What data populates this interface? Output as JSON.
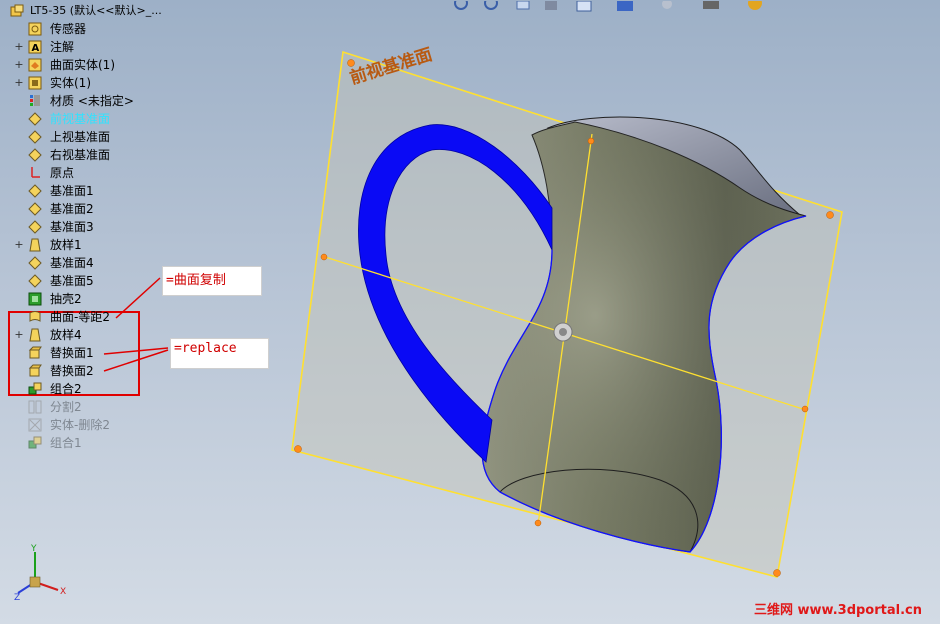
{
  "tree": {
    "root": "LT5-35  (默认<<默认>_...",
    "items": [
      {
        "label": "传感器",
        "icon": "sensor-icon",
        "expander": ""
      },
      {
        "label": "注解",
        "icon": "annotation-icon",
        "expander": "+"
      },
      {
        "label": "曲面实体(1)",
        "icon": "surface-bodies-icon",
        "expander": "+"
      },
      {
        "label": "实体(1)",
        "icon": "solid-bodies-icon",
        "expander": "+"
      },
      {
        "label": "材质 <未指定>",
        "icon": "material-icon",
        "expander": ""
      },
      {
        "label": "前视基准面",
        "icon": "plane-icon",
        "expander": "",
        "state": "selected"
      },
      {
        "label": "上视基准面",
        "icon": "plane-icon",
        "expander": ""
      },
      {
        "label": "右视基准面",
        "icon": "plane-icon",
        "expander": ""
      },
      {
        "label": "原点",
        "icon": "origin-icon",
        "expander": ""
      },
      {
        "label": "基准面1",
        "icon": "plane-icon",
        "expander": ""
      },
      {
        "label": "基准面2",
        "icon": "plane-icon",
        "expander": ""
      },
      {
        "label": "基准面3",
        "icon": "plane-icon",
        "expander": ""
      },
      {
        "label": "放样1",
        "icon": "loft-icon",
        "expander": "+"
      },
      {
        "label": "基准面4",
        "icon": "plane-icon",
        "expander": ""
      },
      {
        "label": "基准面5",
        "icon": "plane-icon",
        "expander": ""
      },
      {
        "label": "抽壳2",
        "icon": "shell-icon",
        "expander": ""
      },
      {
        "label": "曲面-等距2",
        "icon": "offset-surface-icon",
        "expander": ""
      },
      {
        "label": "放样4",
        "icon": "loft-icon",
        "expander": "+"
      },
      {
        "label": "替换面1",
        "icon": "replace-face-icon",
        "expander": ""
      },
      {
        "label": "替换面2",
        "icon": "replace-face-icon",
        "expander": ""
      },
      {
        "label": "组合2",
        "icon": "combine-icon",
        "expander": ""
      },
      {
        "label": "分割2",
        "icon": "split-icon",
        "expander": "",
        "state": "suppressed"
      },
      {
        "label": "实体-删除2",
        "icon": "delete-body-icon",
        "expander": "",
        "state": "suppressed"
      },
      {
        "label": "组合1",
        "icon": "combine-icon",
        "expander": "",
        "state": "suppressed"
      }
    ]
  },
  "annotations": {
    "note1": "=曲面复制",
    "note2": "=replace"
  },
  "viewport": {
    "plane_label": "前视基准面"
  },
  "triad": {
    "x": "X",
    "y": "Y",
    "z": "Z"
  },
  "watermark": "三维网 www.3dportal.cn",
  "colors": {
    "background_top": "#9db0c7",
    "selected_text": "#2fe3ff",
    "plane_edge": "#ffe030",
    "handle_fill": "#3a3cff",
    "annotation_red": "#e00000",
    "body_fill": "#6e725e"
  }
}
